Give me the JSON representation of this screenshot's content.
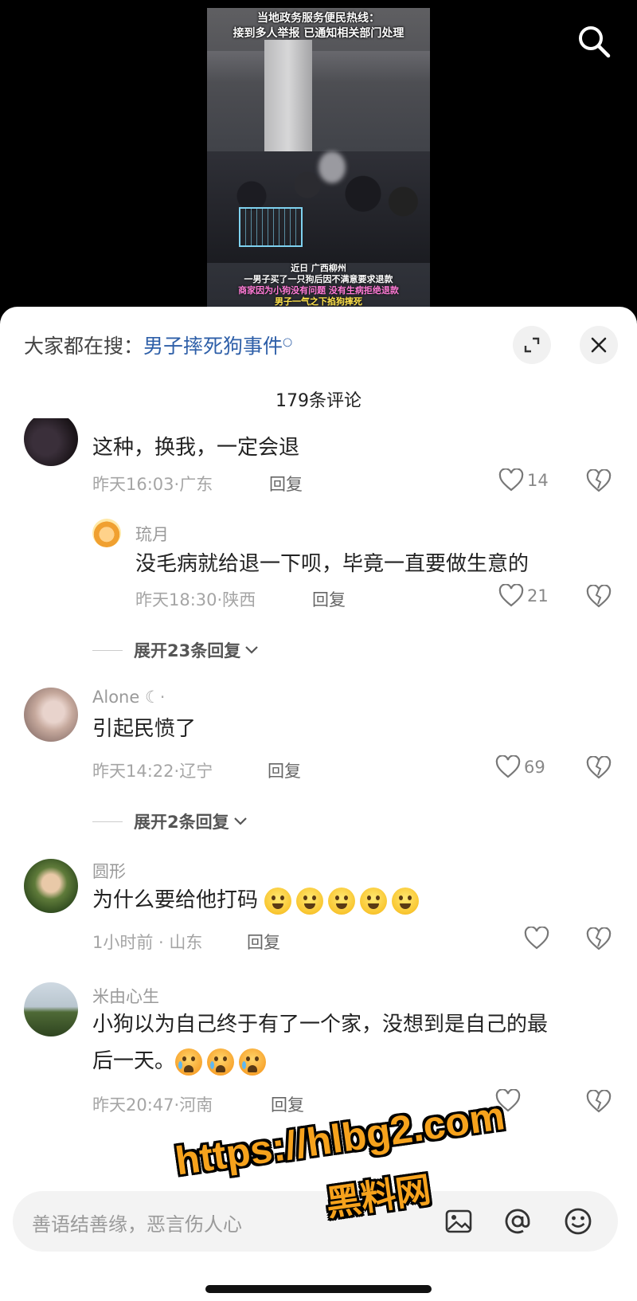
{
  "video": {
    "title_line1": "当地政务服务便民热线：",
    "title_line2": "接到多人举报 已通知相关部门处理",
    "caption_line1": "近日 广西柳州",
    "caption_line2": "一男子买了一只狗后因不满意要求退款",
    "caption_line3": "商家因为小狗没有问题 没有生病拒绝退款",
    "caption_line4": "男子一气之下掐狗摔死"
  },
  "header": {
    "hot_search_prefix": "大家都在搜：",
    "hot_search_query": "男子摔死狗事件",
    "comment_count": "179条评论"
  },
  "comments": [
    {
      "username": "",
      "text": "这种，换我，一定会退",
      "time": "昨天16:03",
      "location": "广东",
      "reply_label": "回复",
      "likes": "14"
    },
    {
      "username": "琉月",
      "text": "没毛病就给退一下呗，毕竟一直要做生意的",
      "time": "昨天18:30",
      "location": "陕西",
      "reply_label": "回复",
      "likes": "21"
    },
    {
      "expand_label": "展开23条回复"
    },
    {
      "username": "Alone",
      "text": "引起民愤了",
      "time": "昨天14:22",
      "location": "辽宁",
      "reply_label": "回复",
      "likes": "69"
    },
    {
      "expand_label": "展开2条回复"
    },
    {
      "username": "圆形",
      "text": "为什么要给他打码",
      "time": "1小时前",
      "location": "山东",
      "reply_label": "回复",
      "likes": ""
    },
    {
      "username": "米由心生",
      "text_line1": "小狗以为自己终于有了一个家，没想到是自己的最",
      "text_line2": "后一天。",
      "time": "昨天20:47",
      "location": "河南",
      "reply_label": "回复",
      "likes": ""
    }
  ],
  "input": {
    "placeholder": "善语结善缘，恶言伤人心"
  },
  "watermark": {
    "url": "https://hlbg2.com",
    "name": "黑料网"
  },
  "colors": {
    "link_blue": "#2e5fa8",
    "watermark_orange": "#f6a21c"
  },
  "icons": [
    "search-icon",
    "expand-icon",
    "close-icon",
    "heart-icon",
    "broken-heart-icon",
    "chevron-down-icon",
    "image-icon",
    "at-icon",
    "emoji-icon"
  ]
}
